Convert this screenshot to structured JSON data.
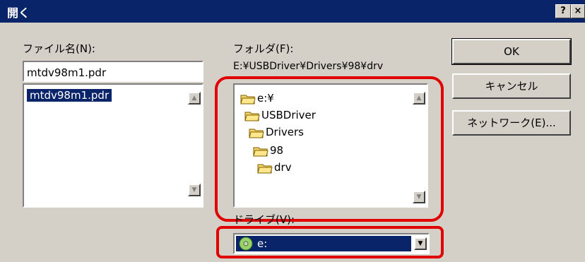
{
  "title": "開く",
  "titlebar_buttons": {
    "help": "?",
    "close": "×"
  },
  "filename": {
    "label": "ファイル名(N):",
    "value": "mtdv98m1.pdr",
    "list": [
      "mtdv98m1.pdr"
    ]
  },
  "folder": {
    "label": "フォルダ(F):",
    "path": "E:¥USBDriver¥Drivers¥98¥drv",
    "tree": [
      {
        "name": "e:¥",
        "icon": "open-folder-icon"
      },
      {
        "name": "USBDriver",
        "icon": "open-folder-icon"
      },
      {
        "name": "Drivers",
        "icon": "open-folder-icon"
      },
      {
        "name": "98",
        "icon": "open-folder-icon"
      },
      {
        "name": "drv",
        "icon": "open-folder-icon"
      }
    ]
  },
  "drive": {
    "label": "ドライブ(V):",
    "value": "e:",
    "icon": "cd-drive-icon"
  },
  "buttons": {
    "ok": "OK",
    "cancel": "キャンセル",
    "network": "ネットワーク(E)..."
  },
  "colors": {
    "titlebar": "#0a246a",
    "highlight": "#e00000",
    "dialog": "#d4d0c8"
  }
}
